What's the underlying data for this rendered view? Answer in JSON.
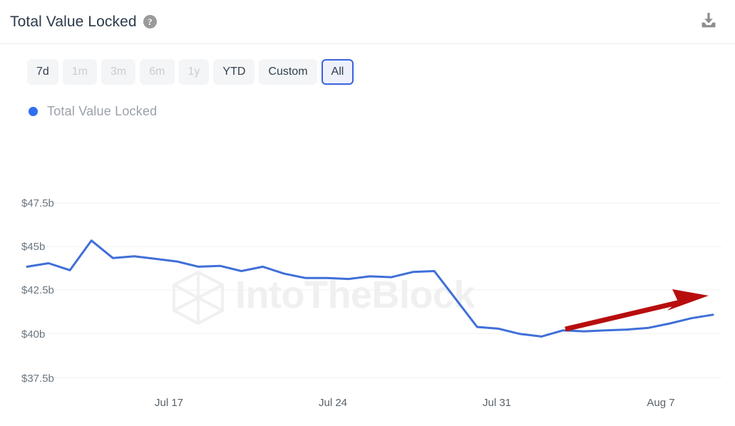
{
  "header": {
    "title": "Total Value Locked",
    "help_icon": "question-mark-circle-icon",
    "download_icon": "download-icon"
  },
  "ranges": {
    "items": [
      {
        "label": "7d",
        "state": "enabled"
      },
      {
        "label": "1m",
        "state": "disabled"
      },
      {
        "label": "3m",
        "state": "disabled"
      },
      {
        "label": "6m",
        "state": "disabled"
      },
      {
        "label": "1y",
        "state": "disabled"
      },
      {
        "label": "YTD",
        "state": "enabled"
      },
      {
        "label": "Custom",
        "state": "enabled"
      },
      {
        "label": "All",
        "state": "selected"
      }
    ]
  },
  "legend": {
    "items": [
      {
        "label": "Total Value Locked",
        "color": "#2f6ff0"
      }
    ]
  },
  "watermark": {
    "text": "IntoTheBlock",
    "mark": "hexagon-cube-logo-icon"
  },
  "annotation": {
    "type": "arrow",
    "color": "#b80d0d",
    "direction": "up-right",
    "meaning": "uptrend-annotation"
  },
  "colors": {
    "series": "#3f6fd8",
    "legend_dot": "#2f6ff0",
    "selected_border": "#3c63dd",
    "selected_fill": "#eef1fb",
    "grid": "#f0f1f3",
    "annotation": "#b80d0d",
    "watermark": "#f0f0f1"
  },
  "chart_data": {
    "type": "line",
    "title": "Total Value Locked",
    "xlabel": "",
    "ylabel": "",
    "grid": true,
    "legend_position": "top-left",
    "ytick_labels": [
      "$47.5b",
      "$45b",
      "$42.5b",
      "$40b",
      "$37.5b"
    ],
    "ytick_values": [
      47.5,
      45,
      42.5,
      40,
      37.5
    ],
    "ylim": [
      37.5,
      47.5
    ],
    "yunit": "billion USD",
    "xtick_labels": [
      "Jul 17",
      "Jul 24",
      "Jul 31",
      "Aug 7"
    ],
    "xtick_positions": [
      7,
      14,
      21,
      28
    ],
    "xlim": [
      0,
      32
    ],
    "series": [
      {
        "name": "Total Value Locked",
        "color": "#3f6fd8",
        "x": [
          0,
          1,
          2,
          3,
          4,
          5,
          6,
          7,
          8,
          9,
          10,
          11,
          12,
          13,
          14,
          15,
          16,
          17,
          18,
          19,
          20,
          21,
          22,
          23,
          24,
          25,
          26,
          27,
          28,
          29,
          30,
          31,
          32
        ],
        "values": [
          43.85,
          44.05,
          43.65,
          45.35,
          44.35,
          44.45,
          44.3,
          44.15,
          43.85,
          43.9,
          43.6,
          43.85,
          43.45,
          43.2,
          43.2,
          43.15,
          43.3,
          43.25,
          43.55,
          43.6,
          42.0,
          40.4,
          40.3,
          40.0,
          39.85,
          40.2,
          40.15,
          40.2,
          40.25,
          40.35,
          40.6,
          40.9,
          41.1
        ]
      }
    ]
  }
}
